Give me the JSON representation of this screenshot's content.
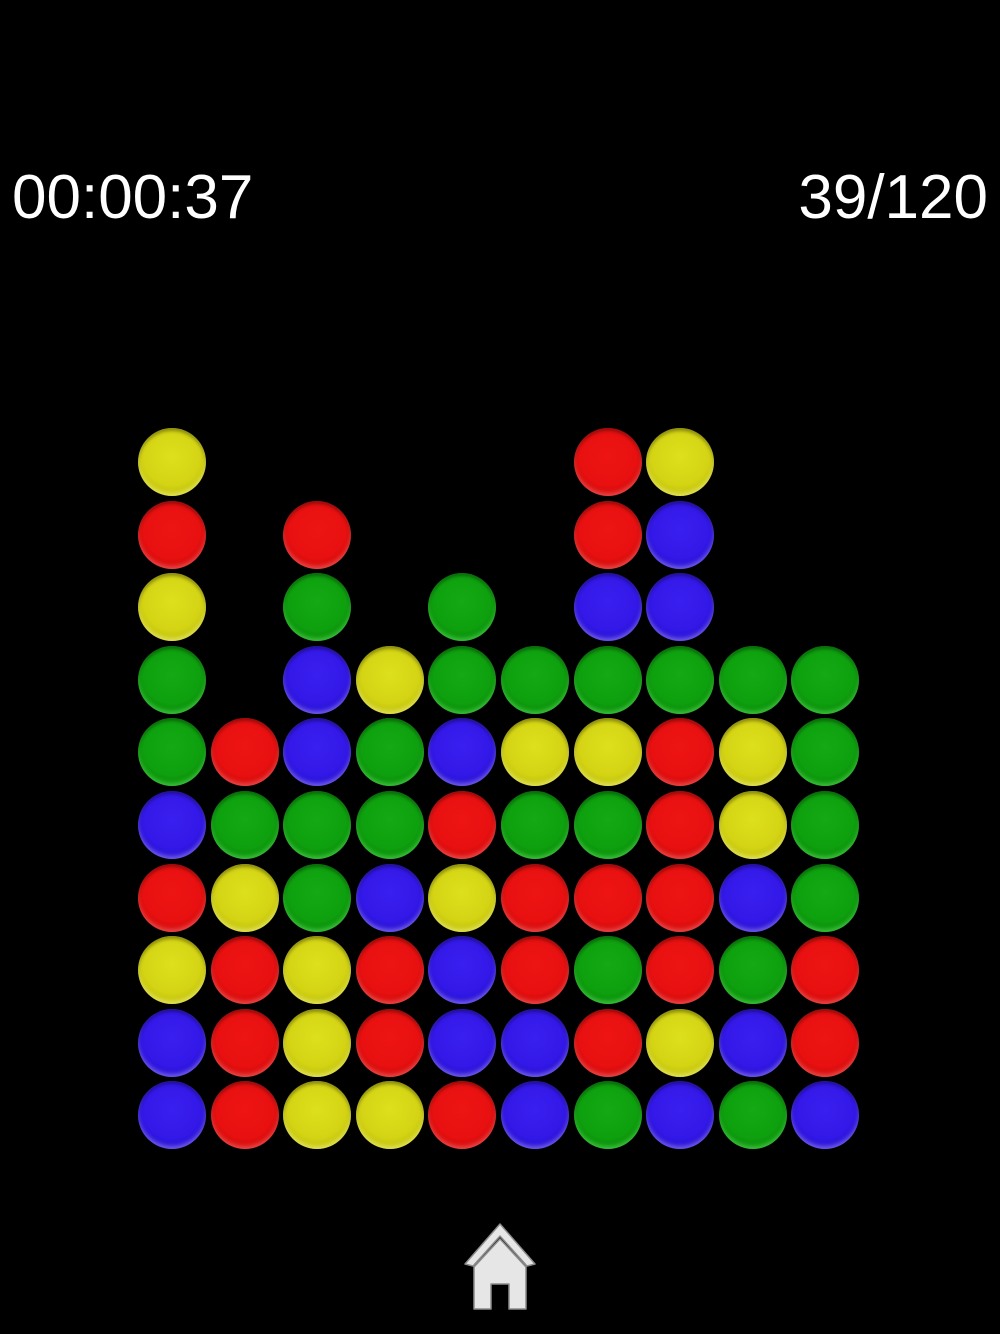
{
  "hud": {
    "timer": "00:00:37",
    "score": "39/120"
  },
  "colors": {
    "background": "#000000",
    "red": "#e81010",
    "yellow": "#d4d414",
    "green": "#0ea00e",
    "blue": "#3318e8",
    "home_icon": "#e6e6e6"
  },
  "board": {
    "rows": 10,
    "cols": 10,
    "grid": [
      [
        "yellow",
        null,
        null,
        null,
        null,
        null,
        "red",
        "yellow",
        null,
        null
      ],
      [
        "red",
        null,
        "red",
        null,
        null,
        null,
        "red",
        "blue",
        null,
        null
      ],
      [
        "yellow",
        null,
        "green",
        null,
        "green",
        null,
        "blue",
        "blue",
        null,
        null
      ],
      [
        "green",
        null,
        "blue",
        "yellow",
        "green",
        "green",
        "green",
        "green",
        "green",
        "green"
      ],
      [
        "green",
        "red",
        "blue",
        "green",
        "blue",
        "yellow",
        "yellow",
        "red",
        "yellow",
        "green"
      ],
      [
        "blue",
        "green",
        "green",
        "green",
        "red",
        "green",
        "green",
        "red",
        "yellow",
        "green"
      ],
      [
        "red",
        "yellow",
        "green",
        "blue",
        "yellow",
        "red",
        "red",
        "red",
        "blue",
        "green"
      ],
      [
        "yellow",
        "red",
        "yellow",
        "red",
        "blue",
        "red",
        "green",
        "red",
        "green",
        "red"
      ],
      [
        "blue",
        "red",
        "yellow",
        "red",
        "blue",
        "blue",
        "red",
        "yellow",
        "blue",
        "red"
      ],
      [
        "blue",
        "red",
        "yellow",
        "yellow",
        "red",
        "blue",
        "green",
        "blue",
        "green",
        "blue"
      ]
    ]
  },
  "footer": {
    "home_icon": "home-icon"
  }
}
